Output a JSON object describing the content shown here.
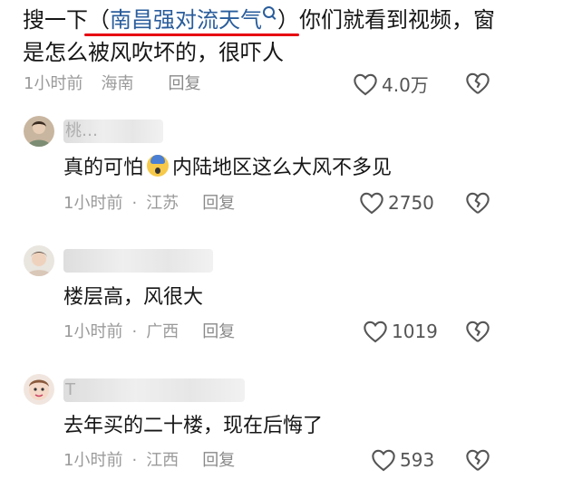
{
  "post": {
    "prefix": "搜一下（",
    "link_text": "南昌强对流天气",
    "suffix": "）你们就看到视频，窗",
    "line2": "是怎么被风吹坏的，很吓人",
    "time": "1小时前",
    "region": "海南",
    "reply": "回复",
    "likes": "4.0万"
  },
  "comments": [
    {
      "username": "桃…",
      "text_a": "真的可怕",
      "text_b": "内陆地区这么大风不多见",
      "time": "1小时前",
      "region": "江苏",
      "reply": "回复",
      "likes": "2750"
    },
    {
      "username": "",
      "text": "楼层高，风很大",
      "time": "1小时前",
      "region": "广西",
      "reply": "回复",
      "likes": "1019"
    },
    {
      "username": "T",
      "text": "去年买的二十楼，现在后悔了",
      "time": "1小时前",
      "region": "江西",
      "reply": "回复",
      "likes": "593"
    }
  ],
  "separator": "·",
  "colors": {
    "link": "#2a5d9c",
    "underline": "#e60012",
    "meta": "#9a9a9a"
  },
  "icons": {
    "like": "heart-outline-icon",
    "dislike": "broken-heart-icon",
    "search": "search-icon",
    "emoji": "scared-face-emoji"
  }
}
